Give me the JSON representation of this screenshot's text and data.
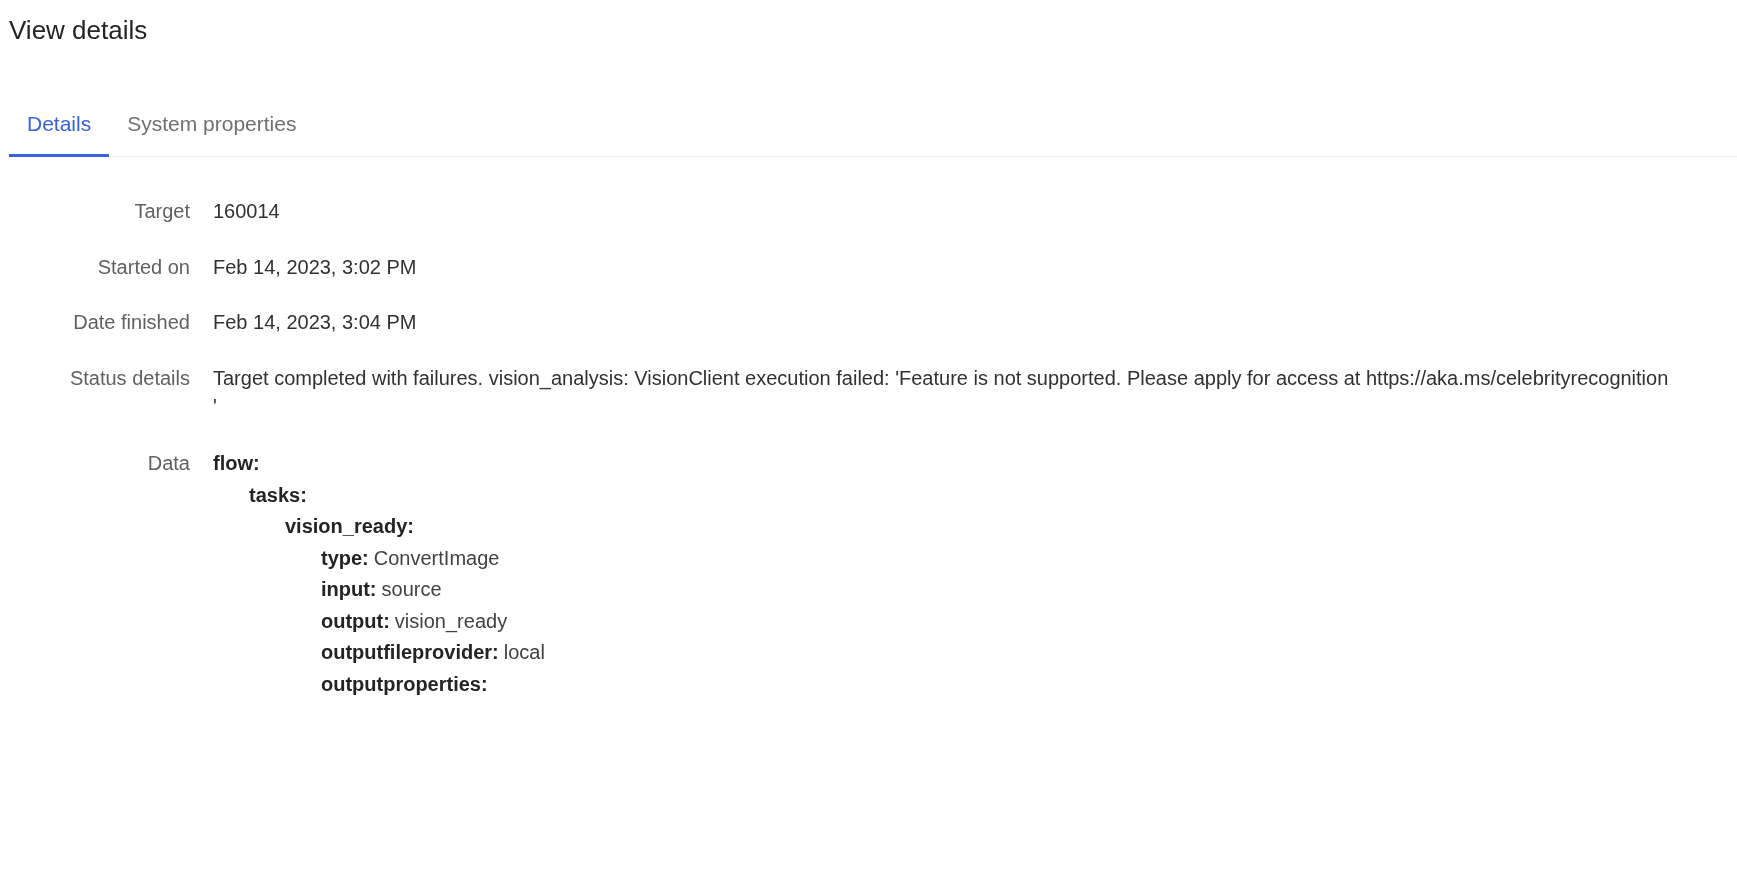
{
  "page_title": "View details",
  "tabs": [
    {
      "label": "Details",
      "selected": true
    },
    {
      "label": "System properties",
      "selected": false
    }
  ],
  "details": [
    {
      "label": "Target",
      "value": "160014"
    },
    {
      "label": "Started on",
      "value": "Feb 14, 2023, 3:02 PM"
    },
    {
      "label": "Date finished",
      "value": "Feb 14, 2023, 3:04 PM"
    },
    {
      "label": "Status details",
      "value": "Target completed with failures. vision_analysis: VisionClient execution failed: 'Feature is not supported. Please apply for access at https://aka.ms/celebrityrecognition\n'"
    }
  ],
  "data": {
    "label": "Data",
    "tree": [
      {
        "key": "flow:",
        "children": [
          {
            "key": "tasks:",
            "children": [
              {
                "key": "vision_ready:",
                "children": [
                  {
                    "key": "type:",
                    "value": "ConvertImage"
                  },
                  {
                    "key": "input:",
                    "value": "source"
                  },
                  {
                    "key": "output:",
                    "value": "vision_ready"
                  },
                  {
                    "key": "outputfileprovider:",
                    "value": "local"
                  },
                  {
                    "key": "outputproperties:"
                  }
                ]
              }
            ]
          }
        ]
      }
    ]
  }
}
